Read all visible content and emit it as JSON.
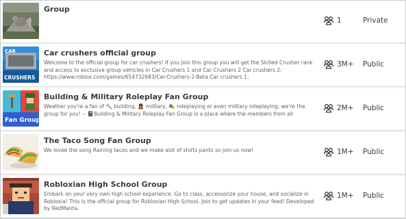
{
  "groups": [
    {
      "name": "Group",
      "description": "",
      "member_count": "1",
      "privacy": "Private",
      "thumbnail": "squirrel-photo"
    },
    {
      "name": "Car crushers official group",
      "description": "Welcome to the official group for car crushers! If you join this group you will get the Skilled Crusher rank and access to exclusive group vehicles in Car Crushers 1 and Car Crushers 2 Car crushers 2: https://www.roblox.com/games/654732683/Car-Crushers-2-Beta Car crushers 1:",
      "member_count": "3M+",
      "privacy": "Public",
      "thumbnail": "car-crushers-logo",
      "thumbnail_text": [
        "CAR",
        "CRUSHERS"
      ]
    },
    {
      "name": "Building & Military Roleplay Fan Group",
      "description": "Weather you're a fan of 🔨 building, 💂 military, 🎭 roleplaying or even military roleplaying; we're the group for you! -- 📓Building & Military Roleplay Fan Group is a place where the members from all",
      "member_count": "2M+",
      "privacy": "Public",
      "thumbnail": "fan-group-logo",
      "thumbnail_text": [
        "Fan Group"
      ]
    },
    {
      "name": "The Taco Song Fan Group",
      "description": "We lovee the song Raining tacos and we make alot of shirts pants so join us now!",
      "member_count": "1M+",
      "privacy": "Public",
      "thumbnail": "tacos-photo"
    },
    {
      "name": "Robloxian High School Group",
      "description": "Embark on your very own high school experience. Go to class, accessorize your house, and socialize in Robloxia! This is the official group for Robloxian High School. Join to get updates in your feed! Developed by RedManta.",
      "member_count": "1M+",
      "privacy": "Public",
      "thumbnail": "high-school-avatar"
    }
  ],
  "icons": {
    "members": "members-icon"
  },
  "colors": {
    "text": "#393b3d",
    "secondary_text": "#606162",
    "border": "#d8dadb"
  }
}
